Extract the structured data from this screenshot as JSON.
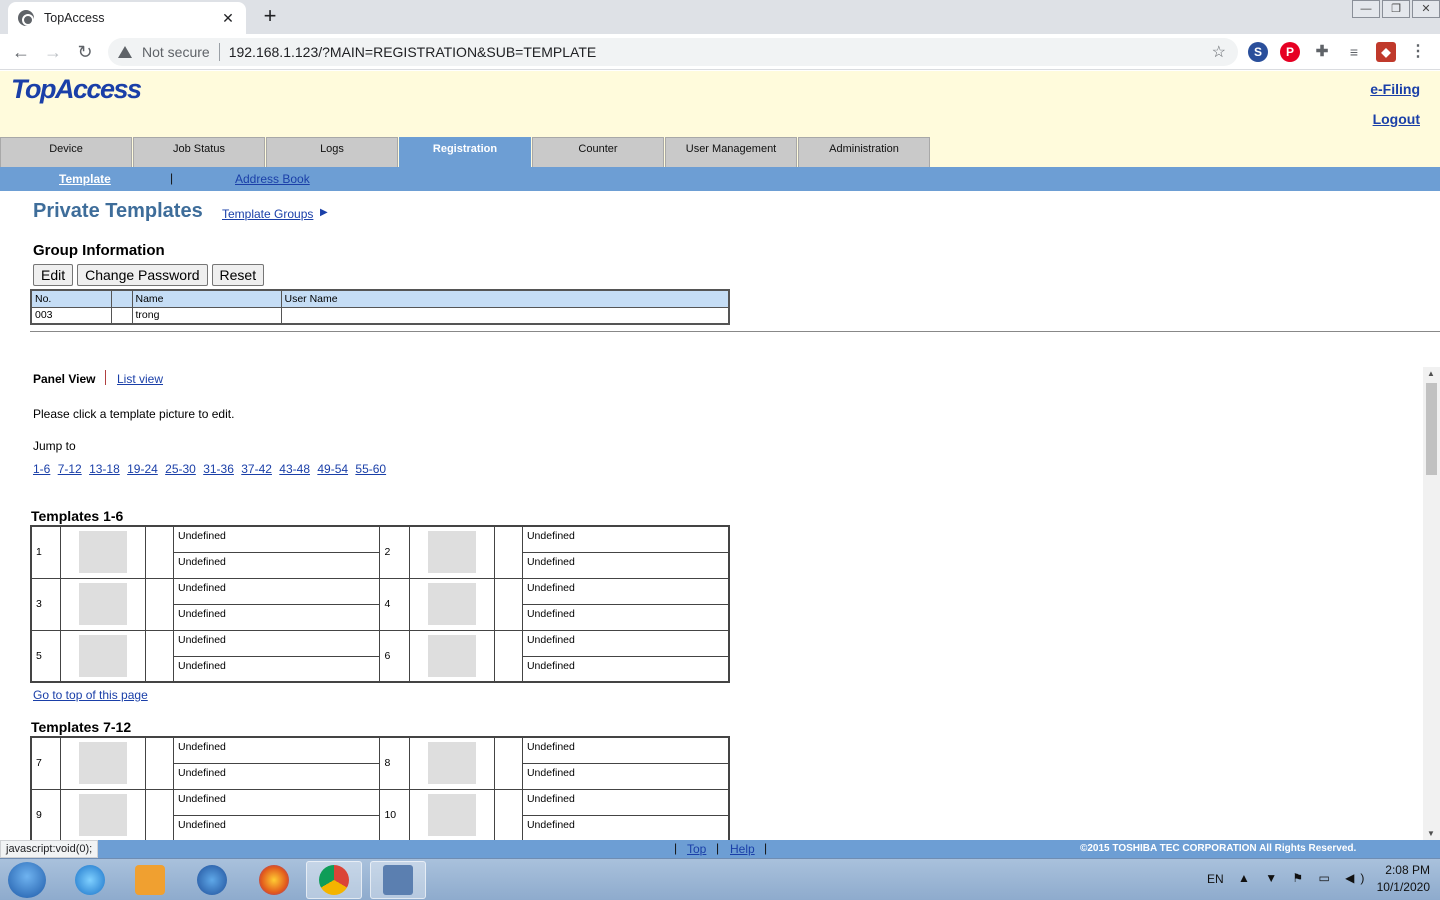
{
  "browser": {
    "tab_title": "TopAccess",
    "new_tab": "+",
    "tab_close": "✕",
    "security_label": "Not secure",
    "url": "192.168.1.123/?MAIN=REGISTRATION&SUB=TEMPLATE",
    "status_url": "javascript:void(0);"
  },
  "header": {
    "logo": "TopAccess",
    "efiling": "e-Filing",
    "logout": "Logout"
  },
  "main_tabs": [
    {
      "label": "Device"
    },
    {
      "label": "Job Status"
    },
    {
      "label": "Logs"
    },
    {
      "label": "Registration",
      "active": true
    },
    {
      "label": "Counter"
    },
    {
      "label": "User Management"
    },
    {
      "label": "Administration"
    }
  ],
  "subnav": {
    "template": "Template",
    "separator": "|",
    "address_book": "Address Book"
  },
  "page": {
    "title": "Private Templates",
    "template_groups": "Template Groups",
    "template_groups_arrow": "▶",
    "group_info_title": "Group Information",
    "buttons": {
      "edit": "Edit",
      "change_password": "Change Password",
      "reset": "Reset"
    },
    "info_table": {
      "headers": [
        "No.",
        "",
        "Name",
        "User Name"
      ],
      "row": [
        "003",
        "",
        "trong",
        ""
      ]
    },
    "panel_view": "Panel View",
    "list_view": "List view",
    "instruction": "Please click a template picture to edit.",
    "jump_to": "Jump to",
    "jump_links": [
      "1-6",
      "7-12",
      "13-18",
      "19-24",
      "25-30",
      "31-36",
      "37-42",
      "43-48",
      "49-54",
      "55-60"
    ],
    "go_top": "Go to top of this page"
  },
  "sections": [
    {
      "title": "Templates 1-6",
      "rows": [
        {
          "left": {
            "num": "1",
            "lines": [
              "Undefined",
              "Undefined"
            ]
          },
          "right": {
            "num": "2",
            "lines": [
              "Undefined",
              "Undefined"
            ]
          }
        },
        {
          "left": {
            "num": "3",
            "lines": [
              "Undefined",
              "Undefined"
            ]
          },
          "right": {
            "num": "4",
            "lines": [
              "Undefined",
              "Undefined"
            ]
          }
        },
        {
          "left": {
            "num": "5",
            "lines": [
              "Undefined",
              "Undefined"
            ]
          },
          "right": {
            "num": "6",
            "lines": [
              "Undefined",
              "Undefined"
            ]
          }
        }
      ]
    },
    {
      "title": "Templates 7-12",
      "rows": [
        {
          "left": {
            "num": "7",
            "lines": [
              "Undefined",
              "Undefined"
            ]
          },
          "right": {
            "num": "8",
            "lines": [
              "Undefined",
              "Undefined"
            ]
          }
        },
        {
          "left": {
            "num": "9",
            "lines": [
              "Undefined",
              "Undefined"
            ]
          },
          "right": {
            "num": "10",
            "lines": [
              "Undefined",
              "Undefined"
            ]
          }
        }
      ]
    }
  ],
  "footer": {
    "top": "Top",
    "help": "Help",
    "separator": "|",
    "copyright": "©2015 TOSHIBA TEC CORPORATION All Rights Reserved."
  },
  "taskbar": {
    "lang": "EN",
    "time": "2:08 PM",
    "date": "10/1/2020"
  },
  "colors": {
    "header_bg": "#fffbdc",
    "accent_blue": "#6d9ed4",
    "title_blue": "#3e6d9a",
    "link_blue": "#1a3fa8"
  }
}
